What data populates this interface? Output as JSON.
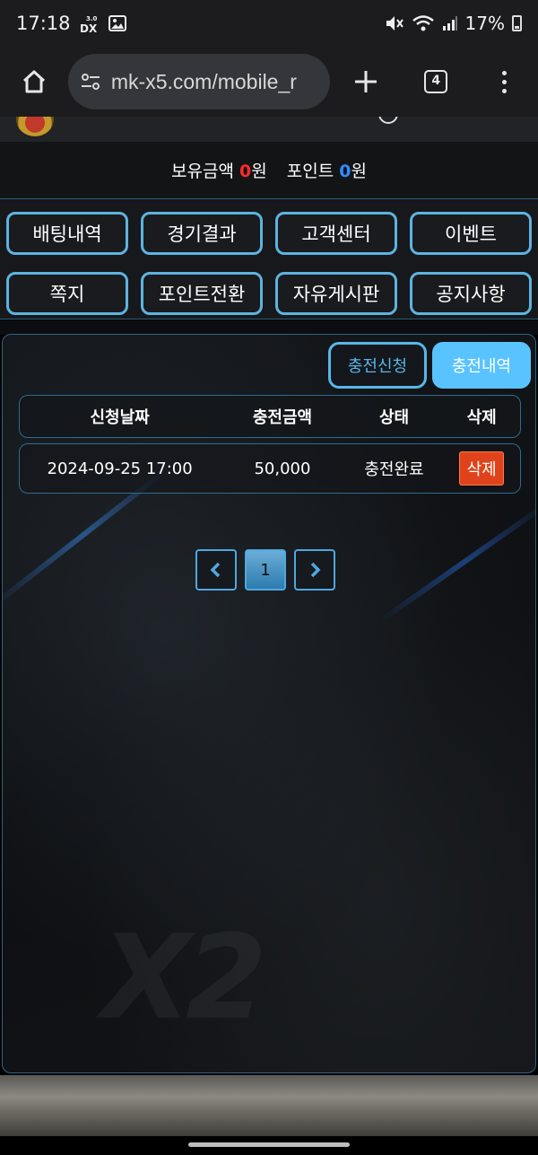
{
  "status_bar": {
    "time": "17:18",
    "left_badge": "3.0 DX",
    "battery": "17%",
    "icons": [
      "mute-icon",
      "wifi-icon",
      "signal-icon",
      "battery-icon"
    ]
  },
  "browser": {
    "url": "mk-x5.com/mobile_r",
    "tab_count": "4",
    "icons": [
      "home-icon",
      "site-settings-icon",
      "plus-icon",
      "tabs-icon",
      "menu-icon"
    ]
  },
  "balance": {
    "money_label": "보유금액",
    "money_value": "0",
    "money_unit": "원",
    "point_label": "포인트",
    "point_value": "0",
    "point_unit": "원",
    "colors": {
      "money": "#ff2a2a",
      "point": "#2f8cff"
    }
  },
  "nav": {
    "items": [
      "배팅내역",
      "경기결과",
      "고객센터",
      "이벤트",
      "쪽지",
      "포인트전환",
      "자유게시판",
      "공지사항"
    ]
  },
  "tabs": {
    "apply": "충전신청",
    "history": "충전내역",
    "active": "history"
  },
  "table": {
    "headers": [
      "신청날짜",
      "충전금액",
      "상태",
      "삭제"
    ],
    "rows": [
      {
        "date": "2024-09-25 17:00",
        "amount": "50,000",
        "status": "충전완료",
        "delete_label": "삭제"
      }
    ]
  },
  "pagination": {
    "current": "1",
    "icons": [
      "chevron-left-icon",
      "chevron-right-icon"
    ]
  },
  "accent_colors": {
    "border": "#5db3e0",
    "active_tab": "#59c3ff",
    "delete": "#e0431b"
  }
}
